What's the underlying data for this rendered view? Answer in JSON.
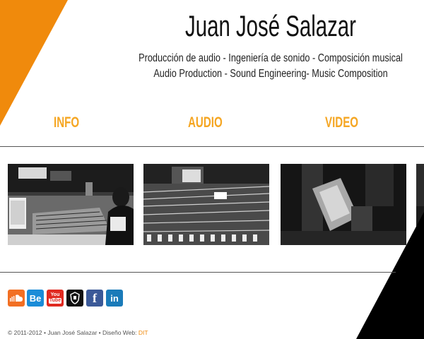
{
  "header": {
    "title": "Juan José Salazar",
    "subtitle_es": "Producción de audio - Ingeniería de sonido - Composición musical",
    "subtitle_en": "Audio Production - Sound Engineering- Music Composition"
  },
  "nav": {
    "items": [
      {
        "label": "INFO"
      },
      {
        "label": "AUDIO"
      },
      {
        "label": "VIDEO"
      }
    ]
  },
  "gallery": {
    "items": [
      {
        "icon": "studio-photo"
      },
      {
        "icon": "mixing-console-photo"
      },
      {
        "icon": "blurred-performance-photo"
      },
      {
        "icon": "partial-photo"
      }
    ]
  },
  "social": {
    "items": [
      {
        "icon": "soundcloud-icon",
        "label": "",
        "color": "#f26f23"
      },
      {
        "icon": "behance-icon",
        "label": "Be",
        "color": "#1a8cd8"
      },
      {
        "icon": "youtube-icon",
        "label": "You",
        "label2": "Tube",
        "color": "#e02a20"
      },
      {
        "icon": "shield-icon",
        "label": "",
        "color": "#111111"
      },
      {
        "icon": "facebook-icon",
        "label": "f",
        "color": "#3b5998"
      },
      {
        "icon": "linkedin-icon",
        "label": "in",
        "color": "#1a7bb9"
      }
    ]
  },
  "footer": {
    "copyright": "© 2011-2012 • Juan José Salazar • Diseño Web:",
    "designer": "DIT"
  },
  "colors": {
    "accent": "#f08a0c",
    "nav": "#f5a623"
  }
}
